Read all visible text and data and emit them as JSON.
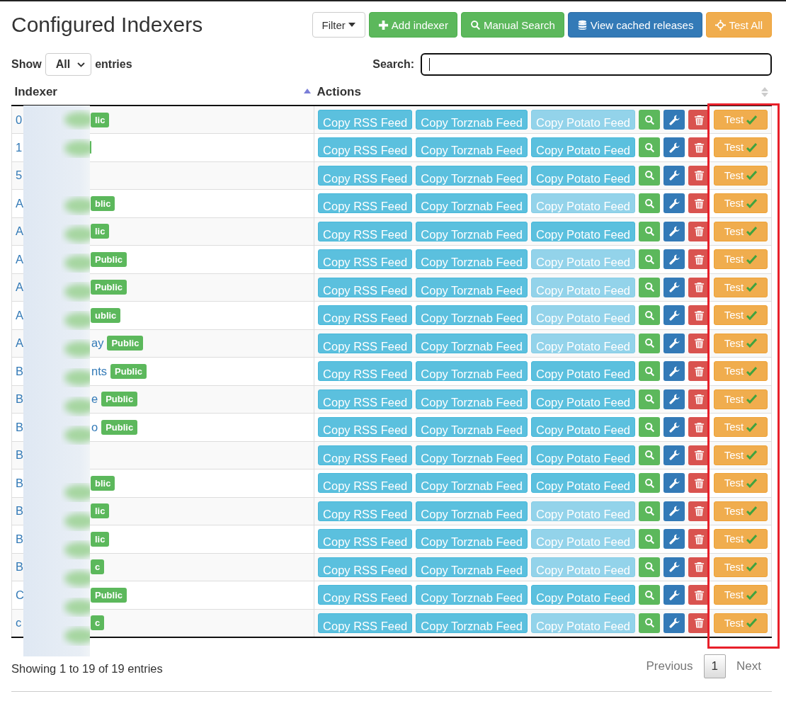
{
  "title": "Configured Indexers",
  "toolbar": [
    {
      "label": "Filter",
      "kind": "dropdown"
    },
    {
      "label": "Add indexer",
      "kind": "add"
    },
    {
      "label": "Manual Search",
      "kind": "search"
    },
    {
      "label": "View cached releases",
      "kind": "cache"
    },
    {
      "label": "Test All",
      "kind": "test"
    }
  ],
  "length": {
    "prefix": "Show",
    "value": "All",
    "suffix": "entries"
  },
  "search": {
    "label": "Search:",
    "focused": true
  },
  "table": {
    "columns": [
      {
        "label": "Indexer",
        "sorted": true
      },
      {
        "label": "Actions",
        "sorted": false
      }
    ],
    "rows": [
      {
        "name": "0",
        "badge": "lic",
        "feeds": [
          "Copy RSS Feed",
          "Copy Torznab Feed",
          "Copy Potato Feed"
        ],
        "potato_disabled": true,
        "test": "Test",
        "test_ok": true
      },
      {
        "name": "1",
        "badge_stub": true,
        "feeds": [
          "Copy RSS Feed",
          "Copy Torznab Feed",
          "Copy Potato Feed"
        ],
        "potato_disabled": false,
        "test": "Test",
        "test_ok": true
      },
      {
        "name": "5",
        "feeds": [
          "Copy RSS Feed",
          "Copy Torznab Feed",
          "Copy Potato Feed"
        ],
        "potato_disabled": false,
        "test": "Test",
        "test_ok": true
      },
      {
        "name": "A",
        "badge": "blic",
        "feeds": [
          "Copy RSS Feed",
          "Copy Torznab Feed",
          "Copy Potato Feed"
        ],
        "potato_disabled": true,
        "test": "Test",
        "test_ok": true
      },
      {
        "name": "A",
        "badge": "lic",
        "feeds": [
          "Copy RSS Feed",
          "Copy Torznab Feed",
          "Copy Potato Feed"
        ],
        "potato_disabled": false,
        "test": "Test",
        "test_ok": true
      },
      {
        "name": "A",
        "badge": "Public",
        "feeds": [
          "Copy RSS Feed",
          "Copy Torznab Feed",
          "Copy Potato Feed"
        ],
        "potato_disabled": true,
        "test": "Test",
        "test_ok": true
      },
      {
        "name": "A",
        "badge": "Public",
        "feeds": [
          "Copy RSS Feed",
          "Copy Torznab Feed",
          "Copy Potato Feed"
        ],
        "potato_disabled": true,
        "test": "Test",
        "test_ok": true
      },
      {
        "name": "A",
        "badge": "ublic",
        "feeds": [
          "Copy RSS Feed",
          "Copy Torznab Feed",
          "Copy Potato Feed"
        ],
        "potato_disabled": true,
        "test": "Test",
        "test_ok": true
      },
      {
        "name": "A",
        "name_end": "ay",
        "badge": "Public",
        "feeds": [
          "Copy RSS Feed",
          "Copy Torznab Feed",
          "Copy Potato Feed"
        ],
        "potato_disabled": true,
        "test": "Test",
        "test_ok": true
      },
      {
        "name": "B",
        "name_end": "nts",
        "badge": "Public",
        "feeds": [
          "Copy RSS Feed",
          "Copy Torznab Feed",
          "Copy Potato Feed"
        ],
        "potato_disabled": false,
        "test": "Test",
        "test_ok": true
      },
      {
        "name": "B",
        "name_end": "e",
        "badge": "Public",
        "feeds": [
          "Copy RSS Feed",
          "Copy Torznab Feed",
          "Copy Potato Feed"
        ],
        "potato_disabled": false,
        "test": "Test",
        "test_ok": true
      },
      {
        "name": "B",
        "name_end": "o",
        "badge": "Public",
        "feeds": [
          "Copy RSS Feed",
          "Copy Torznab Feed",
          "Copy Potato Feed"
        ],
        "potato_disabled": false,
        "test": "Test",
        "test_ok": true
      },
      {
        "name": "B",
        "feeds": [
          "Copy RSS Feed",
          "Copy Torznab Feed",
          "Copy Potato Feed"
        ],
        "potato_disabled": false,
        "test": "Test",
        "test_ok": true
      },
      {
        "name": "B",
        "badge": "blic",
        "feeds": [
          "Copy RSS Feed",
          "Copy Torznab Feed",
          "Copy Potato Feed"
        ],
        "potato_disabled": false,
        "test": "Test",
        "test_ok": true
      },
      {
        "name": "B",
        "badge": "lic",
        "feeds": [
          "Copy RSS Feed",
          "Copy Torznab Feed",
          "Copy Potato Feed"
        ],
        "potato_disabled": true,
        "test": "Test",
        "test_ok": true
      },
      {
        "name": "B",
        "badge": "lic",
        "feeds": [
          "Copy RSS Feed",
          "Copy Torznab Feed",
          "Copy Potato Feed"
        ],
        "potato_disabled": true,
        "test": "Test",
        "test_ok": true
      },
      {
        "name": "B",
        "badge": "c",
        "feeds": [
          "Copy RSS Feed",
          "Copy Torznab Feed",
          "Copy Potato Feed"
        ],
        "potato_disabled": true,
        "test": "Test",
        "test_ok": true
      },
      {
        "name": "C",
        "badge": "Public",
        "feeds": [
          "Copy RSS Feed",
          "Copy Torznab Feed",
          "Copy Potato Feed"
        ],
        "potato_disabled": false,
        "test": "Test",
        "test_ok": true
      },
      {
        "name": "c",
        "badge": "c",
        "feeds": [
          "Copy RSS Feed",
          "Copy Torznab Feed",
          "Copy Potato Feed"
        ],
        "potato_disabled": true,
        "test": "Test",
        "test_ok": true
      }
    ]
  },
  "footer": {
    "info": "Showing 1 to 19 of 19 entries",
    "pages": [
      {
        "label": "Previous",
        "kind": "prev",
        "disabled": true
      },
      {
        "label": "1",
        "kind": "page",
        "selected": true
      },
      {
        "label": "Next",
        "kind": "next",
        "disabled": true
      }
    ]
  },
  "privacy_blur": true,
  "highlight_box": true
}
